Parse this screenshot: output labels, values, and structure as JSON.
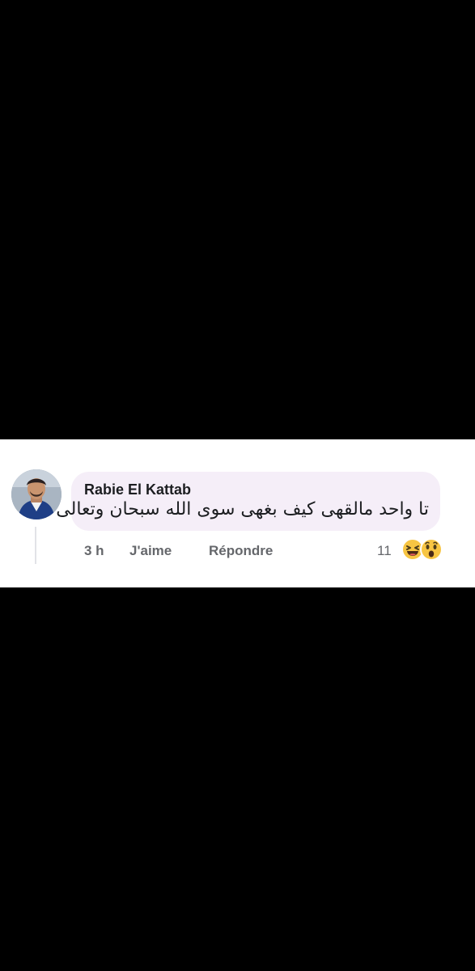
{
  "comment": {
    "author": "Rabie El Kattab",
    "text": "تا واحد مالقهى كيف بغهى سوى الله سبحان وتعالى",
    "time": "3 h",
    "like_label": "J'aime",
    "reply_label": "Répondre",
    "reaction_count": "11",
    "reactions": [
      "haha-icon",
      "wow-icon"
    ]
  },
  "colors": {
    "bubble": "#f5eef8",
    "secondary_text": "#65676b",
    "reaction_yellow": "#f7c543"
  }
}
